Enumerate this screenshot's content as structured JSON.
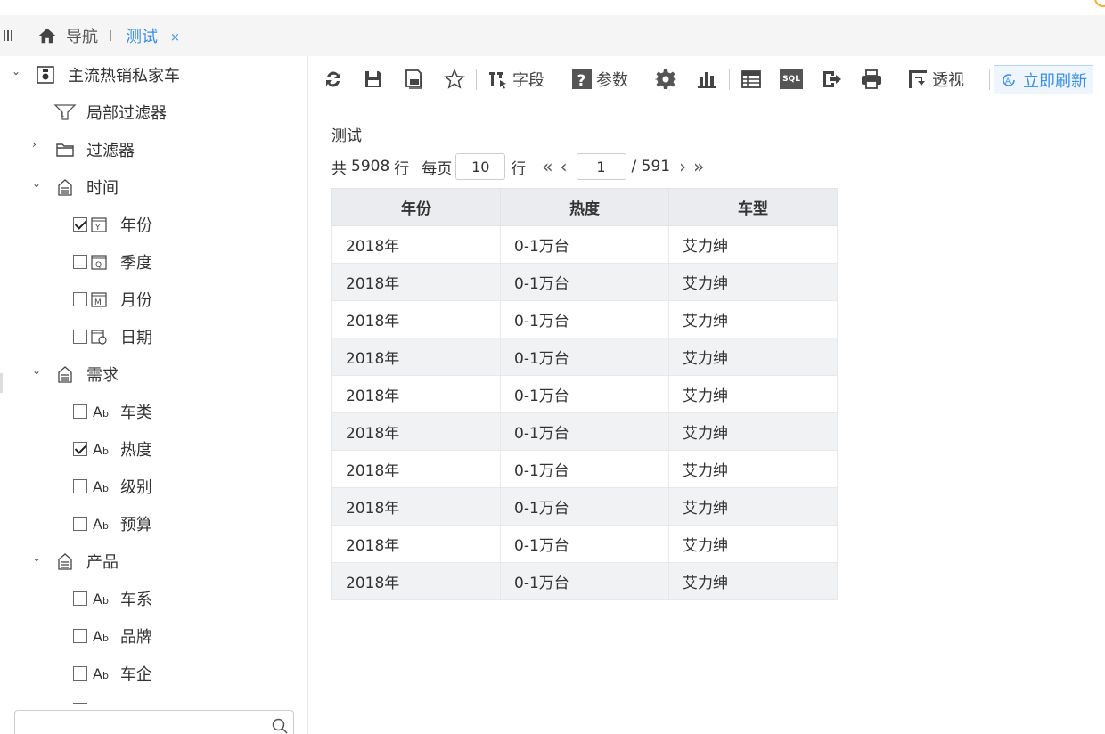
{
  "tabbar": {
    "nav_label": "导航",
    "active_tab": "测试",
    "close_glyph": "×"
  },
  "sidebar": {
    "root": {
      "label": "主流热销私家车",
      "icon": "dataset-icon",
      "expanded": true
    },
    "items": [
      {
        "label": "局部过滤器",
        "icon": "local-filter-icon"
      },
      {
        "label": "过滤器",
        "icon": "folder-icon",
        "expanded": false
      },
      {
        "label": "时间",
        "icon": "dimension-icon",
        "expanded": true,
        "children": [
          {
            "label": "年份",
            "icon": "year-icon",
            "checked": true
          },
          {
            "label": "季度",
            "icon": "quarter-icon",
            "checked": false
          },
          {
            "label": "月份",
            "icon": "month-icon",
            "checked": false
          },
          {
            "label": "日期",
            "icon": "date-icon",
            "checked": false
          }
        ]
      },
      {
        "label": "需求",
        "icon": "dimension-icon",
        "expanded": true,
        "children": [
          {
            "label": "车类",
            "checked": false
          },
          {
            "label": "热度",
            "checked": true
          },
          {
            "label": "级别",
            "checked": false
          },
          {
            "label": "预算",
            "checked": false
          }
        ]
      },
      {
        "label": "产品",
        "icon": "dimension-icon",
        "expanded": true,
        "children": [
          {
            "label": "车系",
            "checked": false
          },
          {
            "label": "品牌",
            "checked": false
          },
          {
            "label": "车企",
            "checked": false
          }
        ]
      }
    ],
    "text_type_glyph": "A",
    "text_type_sub": "b"
  },
  "toolbar": {
    "field_label": "字段",
    "param_label": "参数",
    "pivot_label": "透视",
    "refresh_label": "立即刷新",
    "sql_label": "SQL"
  },
  "content": {
    "title": "测试",
    "pager": {
      "total_prefix": "共",
      "total_rows": "5908",
      "row_unit": "行",
      "per_page_label": "每页",
      "per_page": "10",
      "current_page": "1",
      "total_pages": "/ 591"
    },
    "table": {
      "columns": [
        "年份",
        "热度",
        "车型"
      ],
      "rows": [
        [
          "2018年",
          "0-1万台",
          "艾力绅"
        ],
        [
          "2018年",
          "0-1万台",
          "艾力绅"
        ],
        [
          "2018年",
          "0-1万台",
          "艾力绅"
        ],
        [
          "2018年",
          "0-1万台",
          "艾力绅"
        ],
        [
          "2018年",
          "0-1万台",
          "艾力绅"
        ],
        [
          "2018年",
          "0-1万台",
          "艾力绅"
        ],
        [
          "2018年",
          "0-1万台",
          "艾力绅"
        ],
        [
          "2018年",
          "0-1万台",
          "艾力绅"
        ],
        [
          "2018年",
          "0-1万台",
          "艾力绅"
        ],
        [
          "2018年",
          "0-1万台",
          "艾力绅"
        ]
      ]
    }
  },
  "colors": {
    "accent": "#3a8ee6",
    "header_bg": "#eaecef",
    "stripe": "#f1f2f4"
  }
}
